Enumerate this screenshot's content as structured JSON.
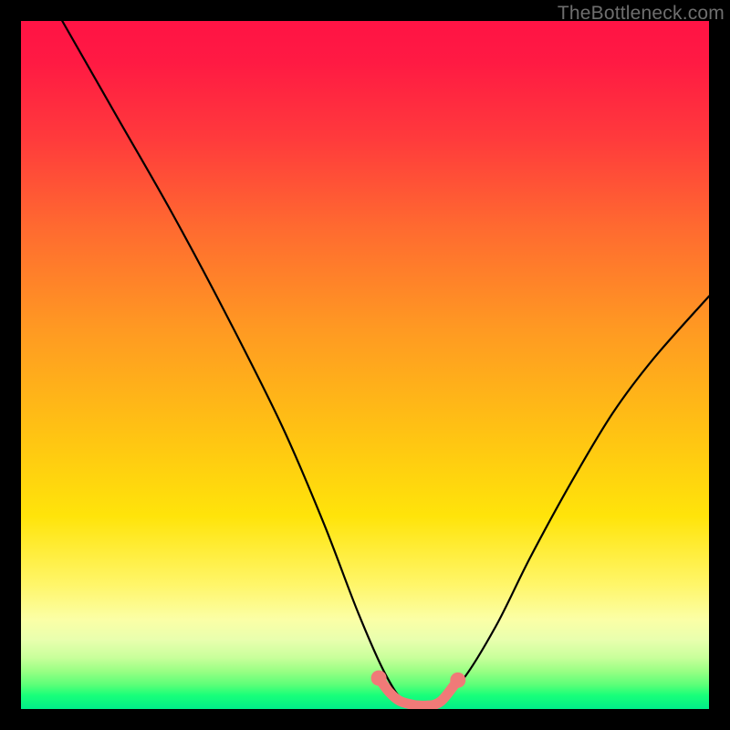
{
  "watermark": "TheBottleneck.com",
  "chart_data": {
    "type": "line",
    "title": "",
    "xlabel": "",
    "ylabel": "",
    "xlim": [
      0,
      100
    ],
    "ylim": [
      0,
      100
    ],
    "grid": false,
    "series": [
      {
        "name": "bottleneck-curve",
        "color": "#000000",
        "x": [
          6,
          14,
          22,
          30,
          38,
          44,
          49,
          53,
          56,
          60,
          64,
          69,
          74,
          80,
          86,
          92,
          100
        ],
        "y": [
          100,
          86,
          72,
          57,
          41,
          27,
          14,
          5,
          1,
          1,
          4,
          12,
          22,
          33,
          43,
          51,
          60
        ]
      },
      {
        "name": "optimal-band",
        "color": "#f07a78",
        "x": [
          52,
          53.5,
          55,
          57,
          58,
          59,
          60,
          61,
          62,
          63.5
        ],
        "y": [
          4.5,
          2.5,
          1.2,
          0.6,
          0.5,
          0.5,
          0.6,
          1.1,
          2.2,
          4.2
        ]
      }
    ],
    "annotations": []
  },
  "colors": {
    "curve": "#000000",
    "band": "#f07a78",
    "gradient_top": "#ff1345",
    "gradient_bottom": "#00ee89",
    "frame": "#000000"
  }
}
